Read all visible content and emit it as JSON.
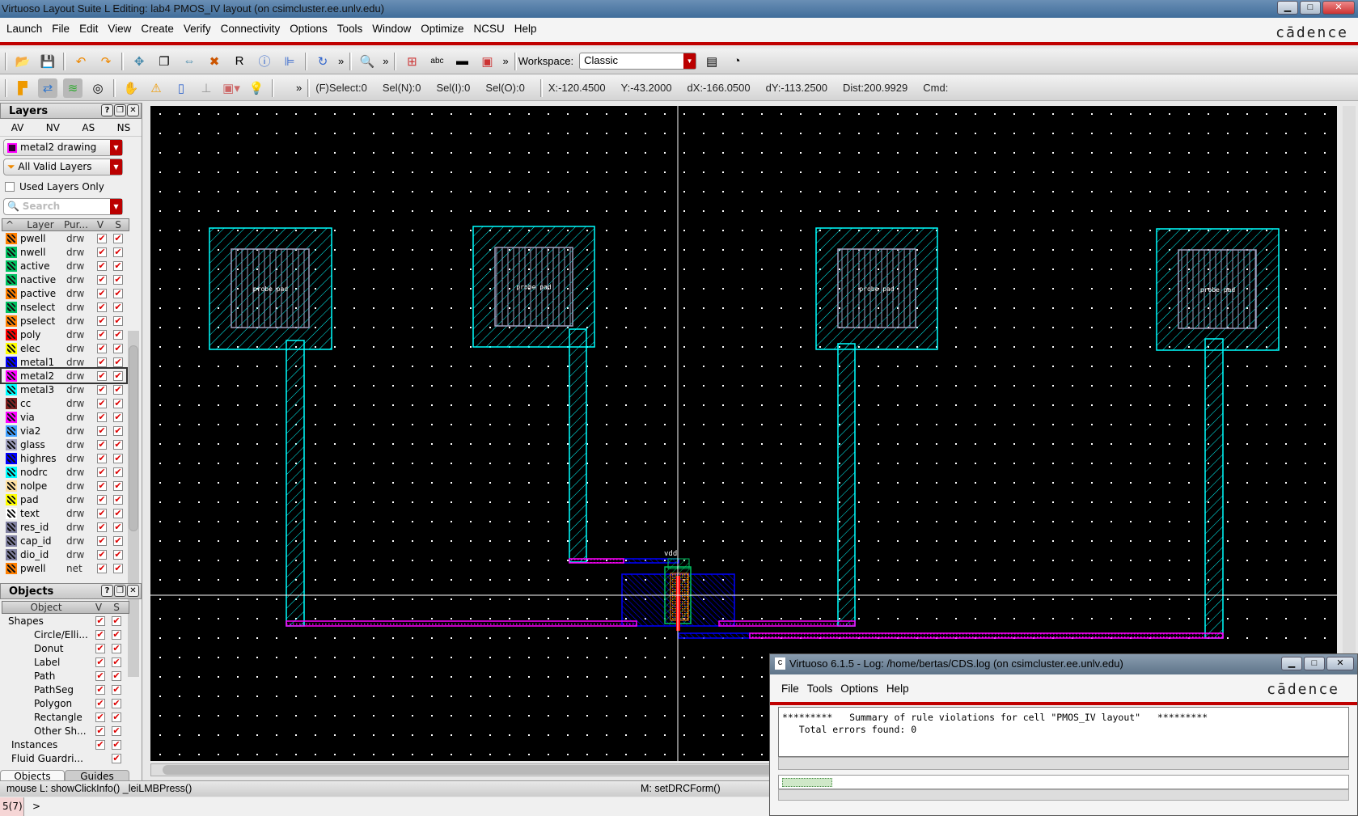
{
  "window": {
    "title": "Virtuoso Layout Suite L Editing: lab4 PMOS_IV layout (on csimcluster.ee.unlv.edu)"
  },
  "menu": [
    "Launch",
    "File",
    "Edit",
    "View",
    "Create",
    "Verify",
    "Connectivity",
    "Options",
    "Tools",
    "Window",
    "Optimize",
    "NCSU",
    "Help"
  ],
  "brand": "cādence",
  "toolbar": {
    "workspace_label": "Workspace:",
    "workspace_value": "Classic",
    "more": "»"
  },
  "status": {
    "fselect": "(F)Select:0",
    "seln": "Sel(N):0",
    "seli": "Sel(I):0",
    "selo": "Sel(O):0",
    "x": "X:-120.4500",
    "y": "Y:-43.2000",
    "dx": "dX:-166.0500",
    "dy": "dY:-113.2500",
    "dist": "Dist:200.9929",
    "cmd": "Cmd:"
  },
  "layers_panel": {
    "title": "Layers",
    "tabs": [
      "AV",
      "NV",
      "AS",
      "NS"
    ],
    "current_layer": "metal2 drawing",
    "filter": "All Valid Layers",
    "used_only": "Used Layers Only",
    "search_placeholder": "Search",
    "columns": [
      "Layer",
      "Pur...",
      "V",
      "S"
    ],
    "layers": [
      {
        "name": "pwell",
        "purpose": "drw",
        "color": "#ff7f00"
      },
      {
        "name": "nwell",
        "purpose": "drw",
        "color": "#00c060"
      },
      {
        "name": "active",
        "purpose": "drw",
        "color": "#00c060"
      },
      {
        "name": "nactive",
        "purpose": "drw",
        "color": "#00c060"
      },
      {
        "name": "pactive",
        "purpose": "drw",
        "color": "#ff7f00"
      },
      {
        "name": "nselect",
        "purpose": "drw",
        "color": "#00c060"
      },
      {
        "name": "pselect",
        "purpose": "drw",
        "color": "#ff7f00"
      },
      {
        "name": "poly",
        "purpose": "drw",
        "color": "#ff0000"
      },
      {
        "name": "elec",
        "purpose": "drw",
        "color": "#ffff00"
      },
      {
        "name": "metal1",
        "purpose": "drw",
        "color": "#0000ff"
      },
      {
        "name": "metal2",
        "purpose": "drw",
        "color": "#ff00ff"
      },
      {
        "name": "metal3",
        "purpose": "drw",
        "color": "#00ffff"
      },
      {
        "name": "cc",
        "purpose": "drw",
        "color": "#802020"
      },
      {
        "name": "via",
        "purpose": "drw",
        "color": "#ff00ff"
      },
      {
        "name": "via2",
        "purpose": "drw",
        "color": "#40a0ff"
      },
      {
        "name": "glass",
        "purpose": "drw",
        "color": "#a0a0c0"
      },
      {
        "name": "highres",
        "purpose": "drw",
        "color": "#0000ff"
      },
      {
        "name": "nodrc",
        "purpose": "drw",
        "color": "#00ffff"
      },
      {
        "name": "nolpe",
        "purpose": "drw",
        "color": "#ffe0a0"
      },
      {
        "name": "pad",
        "purpose": "drw",
        "color": "#ffff00"
      },
      {
        "name": "text",
        "purpose": "drw",
        "color": "#ffffff"
      },
      {
        "name": "res_id",
        "purpose": "drw",
        "color": "#8080a0"
      },
      {
        "name": "cap_id",
        "purpose": "drw",
        "color": "#8080a0"
      },
      {
        "name": "dio_id",
        "purpose": "drw",
        "color": "#8080a0"
      },
      {
        "name": "pwell",
        "purpose": "net",
        "color": "#ff7f00"
      }
    ]
  },
  "objects_panel": {
    "title": "Objects",
    "columns": [
      "Object",
      "V",
      "S"
    ],
    "items": [
      {
        "label": "Shapes",
        "level": 0,
        "v": true
      },
      {
        "label": "Circle/Elli...",
        "level": 1,
        "v": true
      },
      {
        "label": "Donut",
        "level": 1,
        "v": true
      },
      {
        "label": "Label",
        "level": 1,
        "v": true
      },
      {
        "label": "Path",
        "level": 1,
        "v": true
      },
      {
        "label": "PathSeg",
        "level": 1,
        "v": true
      },
      {
        "label": "Polygon",
        "level": 1,
        "v": true
      },
      {
        "label": "Rectangle",
        "level": 1,
        "v": true
      },
      {
        "label": "Other Sh...",
        "level": 1,
        "v": true
      },
      {
        "label": "Instances",
        "level": 0,
        "v": true
      },
      {
        "label": "Fluid Guardri...",
        "level": 0,
        "v": false
      }
    ],
    "tabs": [
      "Objects",
      "Guides"
    ]
  },
  "canvas": {
    "pad_label": "probe pad",
    "pin_label": "vdd",
    "background": "#000000"
  },
  "statusbar": {
    "left": "mouse L: showClickInfo() _leiLMBPress()",
    "mid": "M: setDRCForm()"
  },
  "cmdline": {
    "count": "5(7)",
    "prompt": ">"
  },
  "log": {
    "title": "Virtuoso 6.1.5 - Log: /home/bertas/CDS.log (on csimcluster.ee.unlv.edu)",
    "menu": [
      "File",
      "Tools",
      "Options",
      "Help"
    ],
    "line1": "*********   Summary of rule violations for cell \"PMOS_IV layout\"   *********",
    "line2": "   Total errors found: 0"
  }
}
